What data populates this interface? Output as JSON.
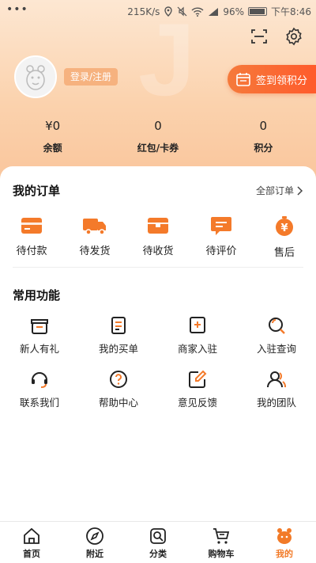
{
  "status_bar": {
    "speed": "215K/s",
    "battery": "96%",
    "time": "下午8:46"
  },
  "profile": {
    "login_label": "登录/注册",
    "signin_label": "签到领积分"
  },
  "stats": [
    {
      "value": "¥0",
      "label": "余额"
    },
    {
      "value": "0",
      "label": "红包/卡券"
    },
    {
      "value": "0",
      "label": "积分"
    }
  ],
  "orders": {
    "title": "我的订单",
    "all_label": "全部订单",
    "items": [
      {
        "label": "待付款",
        "icon": "wallet-icon"
      },
      {
        "label": "待发货",
        "icon": "truck-icon"
      },
      {
        "label": "待收货",
        "icon": "box-icon"
      },
      {
        "label": "待评价",
        "icon": "comment-icon"
      },
      {
        "label": "售后",
        "icon": "after-sales-icon"
      }
    ]
  },
  "functions": {
    "title": "常用功能",
    "items": [
      {
        "label": "新人有礼",
        "icon": "gift-icon"
      },
      {
        "label": "我的买单",
        "icon": "bill-icon"
      },
      {
        "label": "商家入驻",
        "icon": "store-add-icon"
      },
      {
        "label": "入驻查询",
        "icon": "search-icon"
      },
      {
        "label": "联系我们",
        "icon": "headset-icon"
      },
      {
        "label": "帮助中心",
        "icon": "help-icon"
      },
      {
        "label": "意见反馈",
        "icon": "edit-icon"
      },
      {
        "label": "我的团队",
        "icon": "team-icon"
      }
    ]
  },
  "tabs": [
    {
      "label": "首页",
      "icon": "home-icon"
    },
    {
      "label": "附近",
      "icon": "compass-icon"
    },
    {
      "label": "分类",
      "icon": "category-search-icon"
    },
    {
      "label": "购物车",
      "icon": "cart-icon"
    },
    {
      "label": "我的",
      "icon": "mine-icon"
    }
  ],
  "colors": {
    "accent": "#f27a27",
    "signin": "#ff5b2c",
    "hero": "#fbd2ad"
  }
}
